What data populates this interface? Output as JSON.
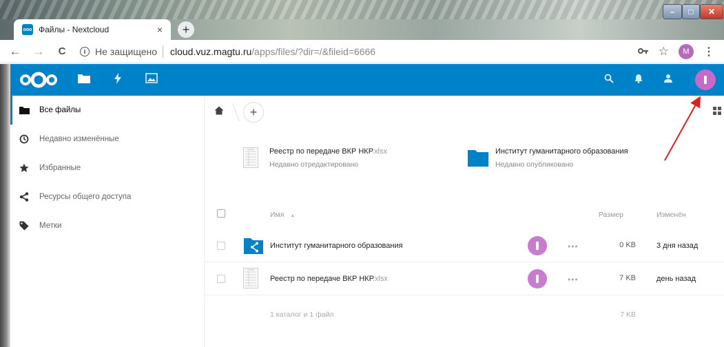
{
  "browser": {
    "tab_title": "Файлы - Nextcloud",
    "tab_close": "×",
    "new_tab": "+",
    "window_min": "–",
    "window_max": "□",
    "window_close": "✕",
    "back": "←",
    "forward": "→",
    "reload": "C",
    "info": "i",
    "insecure_label": "Не защищено",
    "url_host": "cloud.vuz.magtu.ru",
    "url_path": "/apps/files/?dir=/&fileid=6666",
    "profile_initial": "M",
    "menu": "⋮"
  },
  "sidebar": {
    "items": [
      {
        "label": "Все файлы",
        "icon": "folder-icon",
        "active": true
      },
      {
        "label": "Недавно изменённые",
        "icon": "clock-icon"
      },
      {
        "label": "Избранные",
        "icon": "star-icon"
      },
      {
        "label": "Ресурсы общего доступа",
        "icon": "share-icon"
      },
      {
        "label": "Метки",
        "icon": "tag-icon"
      }
    ]
  },
  "main": {
    "add": "+",
    "recent": [
      {
        "name": "Реестр по передаче ВКР НКР",
        "ext": ".xlsx",
        "sub": "Недавно отредактировано",
        "icon": "spreadsheet-icon"
      },
      {
        "name": "Институт гуманитарного образования",
        "ext": "",
        "sub": "Недавно опубликовано",
        "icon": "folder-icon"
      }
    ],
    "columns": {
      "name": "Имя",
      "sort": "▲",
      "size": "Размер",
      "modified": "Изменён"
    },
    "files": [
      {
        "name": "Институт гуманитарного образования",
        "ext": "",
        "size": "0 KB",
        "modified": "3 дня назад",
        "icon": "shared-folder-icon"
      },
      {
        "name": "Реестр по передаче ВКР НКР",
        "ext": ".xlsx",
        "size": "7 KB",
        "modified": "день назад",
        "icon": "spreadsheet-icon"
      }
    ],
    "actions": "•••",
    "summary": "1 каталог и 1 файл",
    "summary_size": "7 KB"
  },
  "colors": {
    "accent": "#0082c9",
    "avatar": "#c56bc7",
    "arrow": "#e02020"
  }
}
